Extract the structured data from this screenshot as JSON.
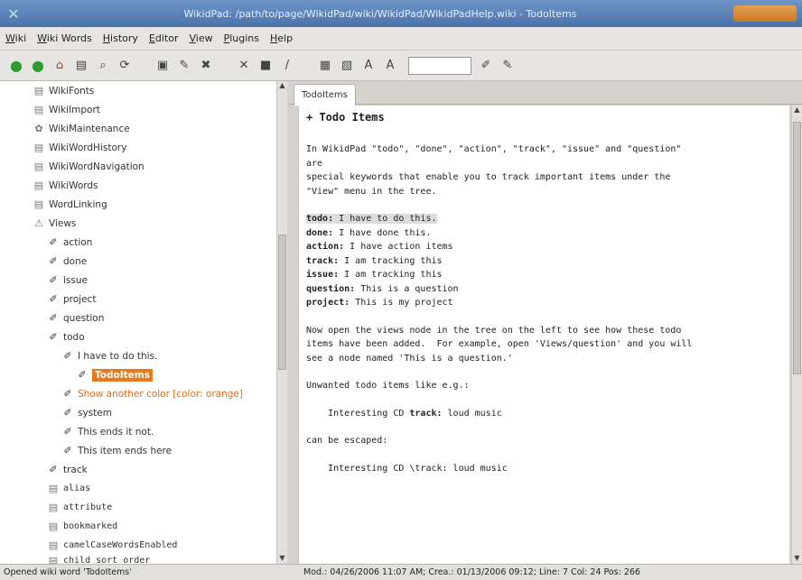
{
  "window": {
    "title": "WikidPad: /path/to/page/WikidPad/wiki/WikidPad/WikidPadHelp.wiki - TodoItems"
  },
  "menu": [
    "Wiki",
    "Wiki Words",
    "History",
    "Editor",
    "View",
    "Plugins",
    "Help"
  ],
  "toolbar": {
    "icons": [
      "back-icon",
      "forward-icon",
      "home-icon",
      "pages-icon",
      "search-icon",
      "refresh-icon",
      "save-icon",
      "new-icon",
      "delete-icon",
      "bold-icon",
      "italic-icon",
      "heading-icon",
      "format-icon",
      "find-icon",
      "zoom-icon",
      "pen-icon",
      "wiki-icon"
    ]
  },
  "tree": {
    "items": [
      {
        "label": "WikiFonts",
        "icon": "page-icon"
      },
      {
        "label": "WikiImport",
        "icon": "page-icon"
      },
      {
        "label": "WikiMaintenance",
        "icon": "gear-icon"
      },
      {
        "label": "WikiWordHistory",
        "icon": "page-icon"
      },
      {
        "label": "WikiWordNavigation",
        "icon": "page-icon"
      },
      {
        "label": "WikiWords",
        "icon": "page-icon"
      },
      {
        "label": "WordLinking",
        "icon": "page-icon"
      },
      {
        "label": "Views",
        "icon": "views-icon"
      },
      {
        "label": "action",
        "icon": "pen-icon"
      },
      {
        "label": "done",
        "icon": "pen-icon"
      },
      {
        "label": "issue",
        "icon": "pen-icon"
      },
      {
        "label": "project",
        "icon": "pen-icon"
      },
      {
        "label": "question",
        "icon": "pen-icon"
      },
      {
        "label": "todo",
        "icon": "pen-icon"
      },
      {
        "label": "I have to do this.",
        "icon": "pen-icon"
      },
      {
        "label": "TodoItems",
        "icon": "pen-icon"
      },
      {
        "label": "Show another color [color: orange]",
        "icon": "pen-icon"
      },
      {
        "label": "system",
        "icon": "pen-icon"
      },
      {
        "label": "This ends it not.",
        "icon": "pen-icon"
      },
      {
        "label": "This item ends here",
        "icon": "pen-icon"
      },
      {
        "label": "track",
        "icon": "pen-icon"
      },
      {
        "label": "alias",
        "icon": "page-icon"
      },
      {
        "label": "attribute",
        "icon": "page-icon"
      },
      {
        "label": "bookmarked",
        "icon": "page-icon"
      },
      {
        "label": "camelCaseWordsEnabled",
        "icon": "page-icon"
      },
      {
        "label": "child_sort_order",
        "icon": "page-icon"
      }
    ]
  },
  "tab": {
    "label": "TodoItems"
  },
  "editor": {
    "heading": "+ Todo Items",
    "intro1": "In WikidPad \"todo\", \"done\", \"action\", \"track\", \"issue\" and \"question\"",
    "intro2": "are",
    "intro3": "special keywords that enable you to track important items under the",
    "intro4": "\"View\" menu in the tree.",
    "kw": [
      {
        "key": "todo:",
        "text": " I have to do this."
      },
      {
        "key": "done:",
        "text": " I have done this."
      },
      {
        "key": "action:",
        "text": " I have action items"
      },
      {
        "key": "track:",
        "text": " I am tracking this"
      },
      {
        "key": "issue:",
        "text": " I am tracking this"
      },
      {
        "key": "question:",
        "text": " This is a question"
      },
      {
        "key": "project:",
        "text": " This is my project"
      }
    ],
    "para1": "Now open the views node in the tree on the left to see how these todo",
    "para2": "items have been added.  For example, open 'Views/question' and you will",
    "para3": "see a node named 'This is a question.'",
    "unwanted": "Unwanted todo items like e.g.:",
    "ex1_pre": "    Interesting CD ",
    "ex1_key": "track:",
    "ex1_post": " loud music",
    "escaped": "can be escaped:",
    "ex2": "    Interesting CD \\track: loud music"
  },
  "status": {
    "left": "Opened wiki word 'TodoItems'",
    "right": "Mod.: 04/26/2006 11:07 AM; Crea.: 01/13/2006 09:12; Line: 7 Col: 24 Pos: 266"
  },
  "colors": {
    "accent": "#e67a1f",
    "titlebar": "#4a73aa"
  }
}
